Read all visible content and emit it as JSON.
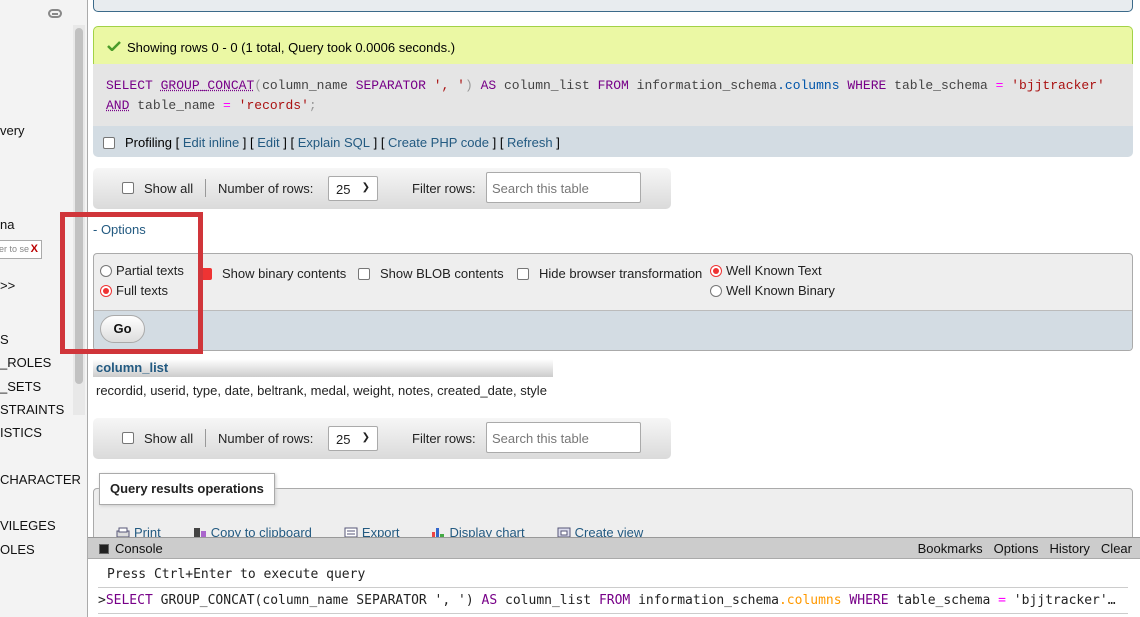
{
  "sidebar": {
    "items": [
      {
        "label": "very",
        "top": 0
      },
      {
        "label": "na"
      },
      {
        "label": ">>"
      },
      {
        "label": "S"
      },
      {
        "label": "_ROLES"
      },
      {
        "label": "_SETS"
      },
      {
        "label": "STRAINTS"
      },
      {
        "label": "ISTICS"
      },
      {
        "label": "CHARACTER"
      },
      {
        "label": "VILEGES"
      },
      {
        "label": "OLES"
      }
    ],
    "filter_placeholder": "er to se",
    "filter_clear": "X"
  },
  "success": {
    "message": "Showing rows 0 - 0 (1 total, Query took 0.0006 seconds.)"
  },
  "sql": {
    "line1": {
      "select": "SELECT",
      "fn": "GROUP_CONCAT",
      "paren_open": "(",
      "col": "column_name ",
      "separator": "SEPARATOR",
      "str1": "', '",
      "paren_close": ")",
      "as": "AS",
      "alias": "column_list ",
      "from": "FROM",
      "schema": "information_schema",
      "dot": ".",
      "table": "columns",
      "where": "WHERE",
      "col2": "table_schema ",
      "eq": "=",
      "str2": "'bjjtracker'"
    },
    "line2": {
      "and": "AND",
      "col": "table_name ",
      "eq": "=",
      "str": "'records'",
      "end": ";"
    }
  },
  "profiling": {
    "label": "Profiling",
    "links": [
      "Edit inline",
      "Edit",
      "Explain SQL",
      "Create PHP code",
      "Refresh"
    ]
  },
  "navbar": {
    "show_all": "Show all",
    "rows_label": "Number of rows:",
    "rows_value": "25",
    "filter_label": "Filter rows:",
    "filter_placeholder": "Search this table"
  },
  "options": {
    "toggle_label": "- Options",
    "partial_texts": "Partial texts",
    "full_texts": "Full texts",
    "show_binary": "Show binary contents",
    "show_blob": "Show BLOB contents",
    "hide_transform": "Hide browser transformation",
    "wkt": "Well Known Text",
    "wkb": "Well Known Binary",
    "go": "Go"
  },
  "result": {
    "column_header": "column_list",
    "value": "recordid, userid, type, date, beltrank, medal, weight, notes, created_date, style"
  },
  "qro": {
    "legend": "Query results operations",
    "actions": [
      "Print",
      "Copy to clipboard",
      "Export",
      "Display chart",
      "Create view"
    ]
  },
  "console": {
    "title": "Console",
    "links": [
      "Bookmarks",
      "Options",
      "History",
      "Clear"
    ],
    "hint": "Press Ctrl+Enter to execute query",
    "prompt": ">",
    "q": {
      "select": "SELECT",
      "part1": " GROUP_CONCAT(column_name SEPARATOR ', ') ",
      "as": "AS",
      "part2": " column_list ",
      "from": "FROM",
      "part3": " information_schema",
      "dotcol": ".columns",
      "part4": " ",
      "where": "WHERE",
      "part5": " table_schema ",
      "eq": "=",
      "part6": " 'bjjtracker'…"
    }
  },
  "colors": {
    "highlight_box": "#d0353a",
    "link": "#235a81",
    "success_bg": "#ebf8a4",
    "radio_accent": "#ee3333"
  }
}
